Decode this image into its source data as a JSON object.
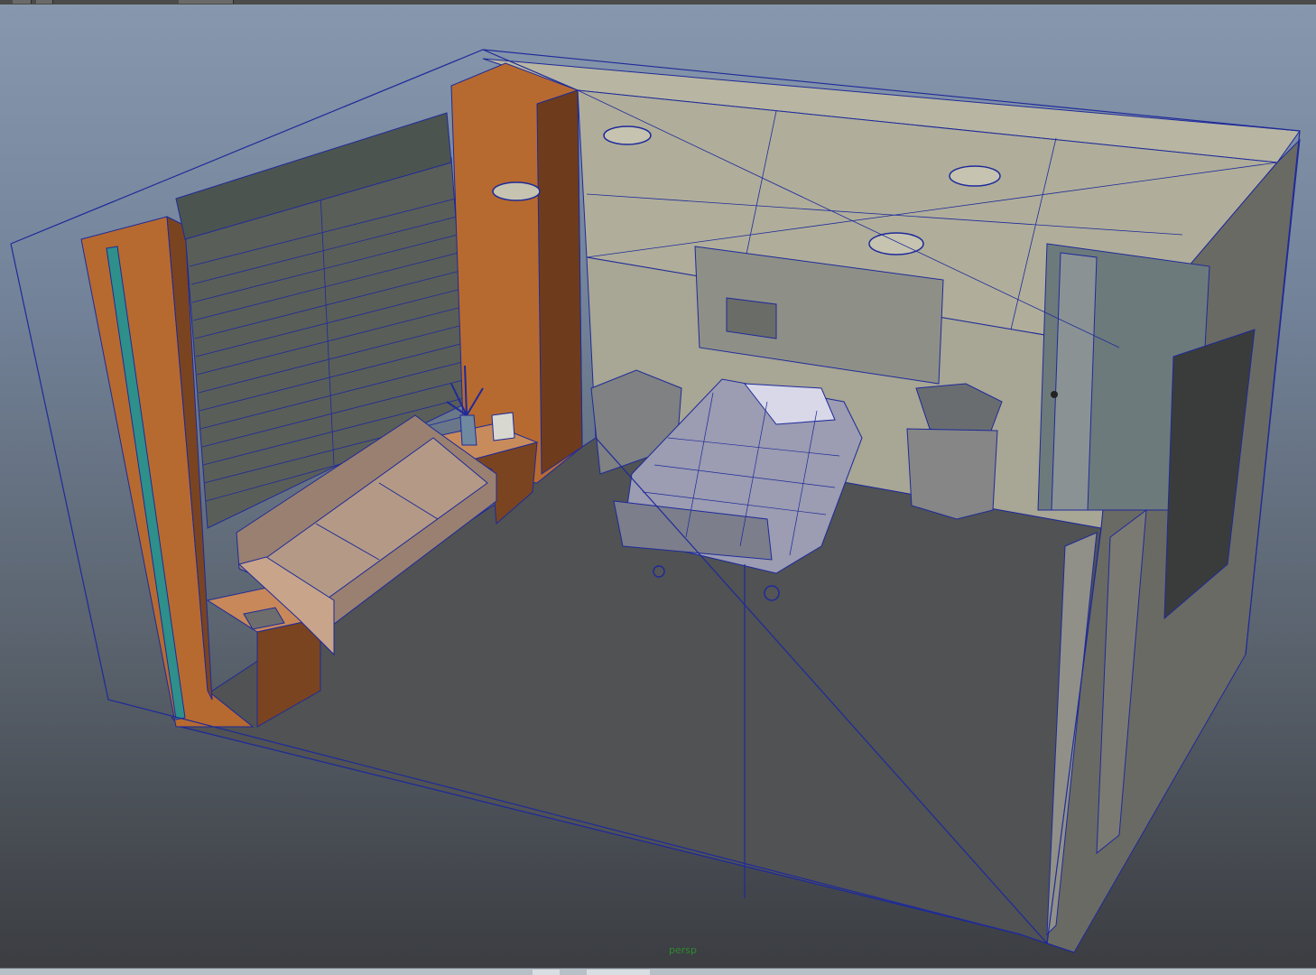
{
  "viewport": {
    "camera_label": "persp",
    "colors": {
      "wire": "#1e2a9a",
      "floor": "#505254",
      "ceiling": "#b8b6a2",
      "back_wall": "#a8a694",
      "right_wall": "#6a6a64",
      "wood": "#b76a30",
      "wood_dark": "#7a4420",
      "teal": "#2f8f8a"
    }
  },
  "icons": {
    "top_toolbar": [
      "toolbar-button-icon",
      "toolbar-button-icon",
      "toolbar-button-icon"
    ],
    "scene_objects": [
      "ceiling-light-icon",
      "hospital-bed-icon",
      "sofa-icon",
      "patient-monitor-icon",
      "window-blinds-icon",
      "door-icon"
    ]
  }
}
